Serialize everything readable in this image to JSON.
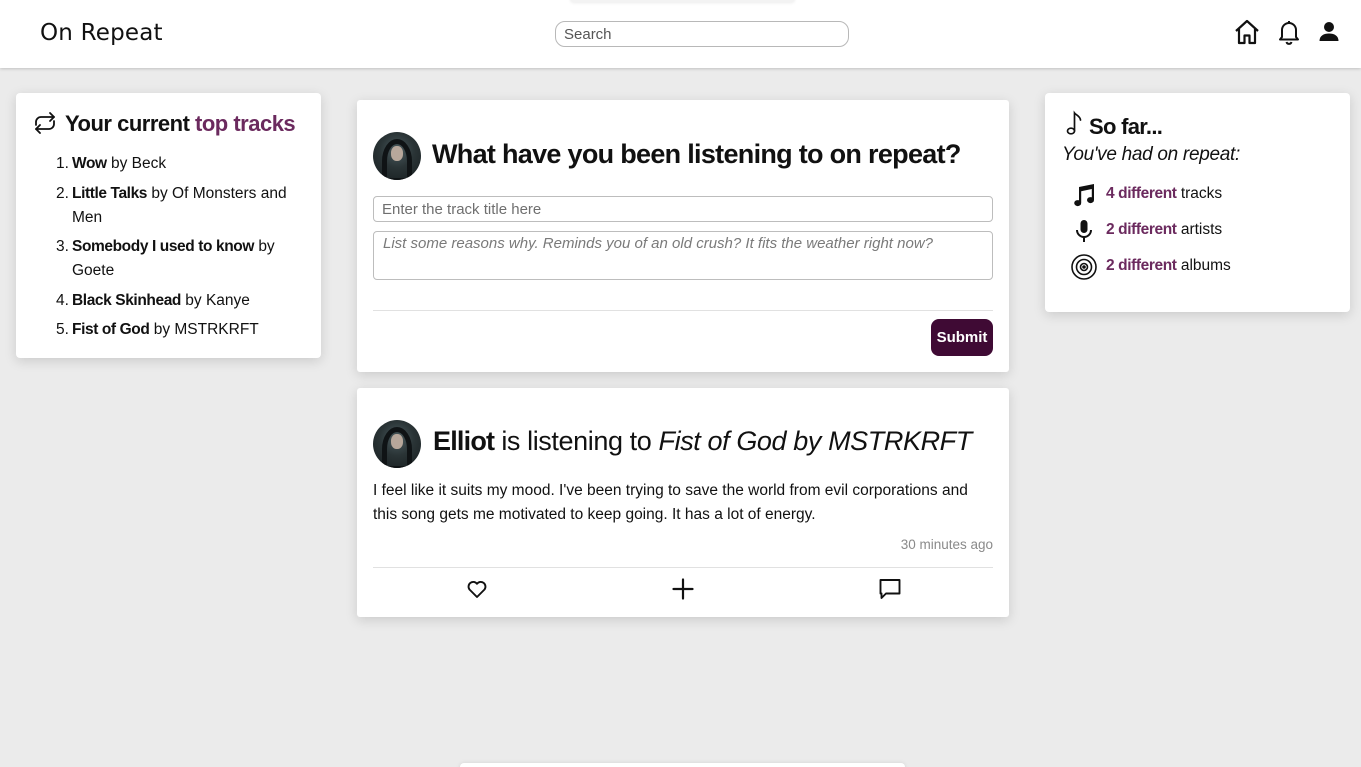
{
  "header": {
    "brand": "On Repeat",
    "search_placeholder": "Search",
    "icons": [
      "home-icon",
      "bell-icon",
      "user-icon"
    ]
  },
  "top_tracks": {
    "title_prefix": "Your current",
    "title_accent": "top tracks",
    "icon": "repeat-icon",
    "items": [
      {
        "num": "1.",
        "title": "Wow",
        "by": "by Beck"
      },
      {
        "num": "2.",
        "title": "Little Talks",
        "by": "by Of Monsters and Men"
      },
      {
        "num": "3.",
        "title": "Somebody I used to know",
        "by": "by Goete"
      },
      {
        "num": "4.",
        "title": "Black Skinhead",
        "by": "by Kanye"
      },
      {
        "num": "5.",
        "title": "Fist of God",
        "by": "by MSTRKRFT"
      }
    ]
  },
  "compose": {
    "heading": "What have you been listening to on repeat?",
    "title_placeholder": "Enter the track title here",
    "reasons_placeholder": "List some reasons why. Reminds you of an old crush? It fits the weather right now?",
    "submit_label": "Submit"
  },
  "post": {
    "user": "Elliot",
    "verb": "is listening to",
    "track": "Fist of God by MSTRKRFT",
    "body": "I feel like it suits my mood. I've been trying to save the world from evil corporations and this song gets me motivated to keep going. It has a lot of energy.",
    "time": "30 minutes ago",
    "actions": [
      "heart-icon",
      "plus-icon",
      "comment-icon"
    ]
  },
  "so_far": {
    "title": "So far...",
    "subtitle": "You've had on repeat:",
    "stats": [
      {
        "count": "4 different",
        "label": "tracks",
        "icon": "music-notes-icon"
      },
      {
        "count": "2 different",
        "label": "artists",
        "icon": "microphone-icon"
      },
      {
        "count": "2 different",
        "label": "albums",
        "icon": "vinyl-icon"
      }
    ]
  },
  "colors": {
    "accent": "#6b2a5e",
    "button": "#3f0a34",
    "background": "#ebebeb"
  }
}
